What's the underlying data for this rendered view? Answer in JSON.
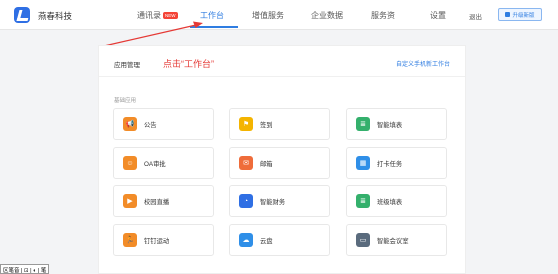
{
  "brand": {
    "name": "燕春科技"
  },
  "nav": {
    "items": [
      {
        "label": "通讯录",
        "badge": "NEW"
      },
      {
        "label": "工作台",
        "active": true
      },
      {
        "label": "增值服务"
      },
      {
        "label": "企业数据"
      },
      {
        "label": "服务资"
      },
      {
        "label": "设置"
      },
      {
        "label": "退出"
      }
    ],
    "upgrade_label": "升级新版"
  },
  "annotation": {
    "text": "点击“工作台”",
    "color": "#e53935"
  },
  "panel": {
    "title": "应用管理",
    "customize_link": "自定义手机新工作台",
    "group_label": "基础应用"
  },
  "apps": [
    {
      "label": "公告",
      "icon": "megaphone-icon",
      "glyph": "📢",
      "color": "#f28c28"
    },
    {
      "label": "签到",
      "icon": "location-pin-icon",
      "glyph": "⚑",
      "color": "#f4b400"
    },
    {
      "label": "智能填表",
      "icon": "form-icon",
      "glyph": "≣",
      "color": "#34b06c"
    },
    {
      "label": "OA审批",
      "icon": "person-icon",
      "glyph": "☺",
      "color": "#f28c28"
    },
    {
      "label": "邮箱",
      "icon": "mail-icon",
      "glyph": "✉",
      "color": "#ef6c3a"
    },
    {
      "label": "打卡任务",
      "icon": "calendar-icon",
      "glyph": "▦",
      "color": "#2f8fe8"
    },
    {
      "label": "校园直播",
      "icon": "play-icon",
      "glyph": "▶",
      "color": "#f28c28"
    },
    {
      "label": "智能财务",
      "icon": "finance-icon",
      "glyph": "◔",
      "color": "#2f6fe4"
    },
    {
      "label": "班级填表",
      "icon": "class-form-icon",
      "glyph": "≣",
      "color": "#34b06c"
    },
    {
      "label": "钉钉运动",
      "icon": "running-icon",
      "glyph": "🏃",
      "color": "#f28c28"
    },
    {
      "label": "云盘",
      "icon": "cloud-icon",
      "glyph": "☁",
      "color": "#2f8fe8"
    },
    {
      "label": "智能会议室",
      "icon": "monitor-icon",
      "glyph": "▭",
      "color": "#5a6b7d"
    }
  ],
  "taskbar": {
    "text": "区笔音 | ⊡ | ◐ | 笔"
  },
  "colors": {
    "accent": "#2f7de1",
    "annotation": "#e53935"
  }
}
